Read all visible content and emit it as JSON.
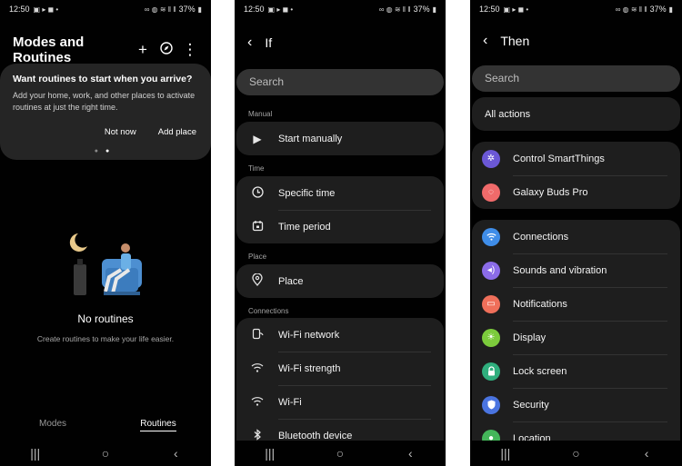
{
  "status": {
    "time": "12:50",
    "battery": "37%"
  },
  "screen1": {
    "title": "Modes and Routines",
    "banner": {
      "title": "Want routines to start when you arrive?",
      "body": "Add your home, work, and other places to activate routines at just the right time.",
      "not_now": "Not now",
      "add_place": "Add place"
    },
    "empty_title": "No routines",
    "empty_subtitle": "Create routines to make your life easier.",
    "tabs": {
      "modes": "Modes",
      "routines": "Routines",
      "active": "Routines"
    }
  },
  "screen2": {
    "title": "If",
    "search_placeholder": "Search",
    "sections": {
      "manual": "Manual",
      "time": "Time",
      "place": "Place",
      "connections": "Connections"
    },
    "items": {
      "start_manually": "Start manually",
      "specific_time": "Specific time",
      "time_period": "Time period",
      "place": "Place",
      "wifi_network": "Wi-Fi network",
      "wifi_strength": "Wi-Fi strength",
      "wifi": "Wi-Fi",
      "bluetooth_device": "Bluetooth device"
    }
  },
  "screen3": {
    "title": "Then",
    "search_placeholder": "Search",
    "all_actions": "All actions",
    "items": [
      {
        "label": "Control SmartThings",
        "icon": "smartthings-icon",
        "color": "#6b58d6"
      },
      {
        "label": "Galaxy Buds Pro",
        "icon": "buds-icon",
        "color": "#f06a6a"
      },
      {
        "label": "Connections",
        "icon": "wifi-icon",
        "color": "#3f8de8"
      },
      {
        "label": "Sounds and vibration",
        "icon": "volume-icon",
        "color": "#8b6ce8"
      },
      {
        "label": "Notifications",
        "icon": "notification-icon",
        "color": "#ef6f5a"
      },
      {
        "label": "Display",
        "icon": "brightness-icon",
        "color": "#7ccb3c"
      },
      {
        "label": "Lock screen",
        "icon": "lock-icon",
        "color": "#2fae7d"
      },
      {
        "label": "Security",
        "icon": "shield-icon",
        "color": "#4a74e0"
      },
      {
        "label": "Location",
        "icon": "location-icon",
        "color": "#44b65a"
      }
    ]
  },
  "navbar": {
    "recents": "|||",
    "home": "○",
    "back": "‹"
  }
}
